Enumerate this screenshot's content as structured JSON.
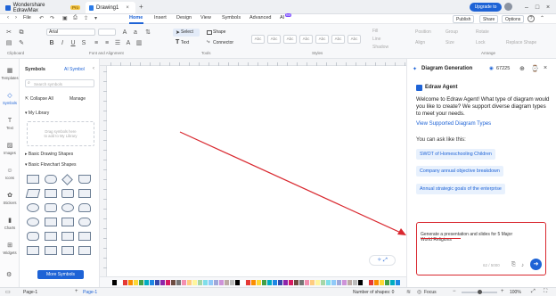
{
  "titlebar": {
    "app_tab": "Wondershare EdrawMax",
    "pro": "Pro",
    "doc_tab": "Drawing1",
    "upgrade": "Upgrade to"
  },
  "menubar": {
    "file": "File",
    "items": [
      "Home",
      "Insert",
      "Design",
      "View",
      "Symbols",
      "Advanced",
      "AI"
    ],
    "ai_badge": "hot",
    "publish": "Publish",
    "share": "Share",
    "options": "Options"
  },
  "ribbon": {
    "font": "Arial",
    "select": "Select",
    "shape": "Shape",
    "text": "Text",
    "connector": "Connector",
    "style_label": "Abc",
    "fill": "Fill",
    "line": "Line",
    "shadow": "Shadow",
    "position": "Position",
    "align": "Align",
    "size": "Size",
    "group": "Group",
    "rotate": "Rotate",
    "lock": "Lock",
    "replace_shape": "Replace Shape",
    "groups": [
      "Clipboard",
      "Font and Alignment",
      "Tools",
      "Styles",
      "Arrange"
    ]
  },
  "rail": [
    "Templates",
    "Symbols",
    "Text",
    "Images",
    "Icons",
    "Stickers",
    "Charts",
    "Widgets"
  ],
  "symbols": {
    "title": "Symbols",
    "ai_symbol": "AI Symbol",
    "search_placeholder": "Search symbols",
    "collapse": "Collapse All",
    "manage": "Manage",
    "library": "My Library",
    "drag_hint_1": "Drag symbols here",
    "drag_hint_2": "to add to My Library",
    "basic_drawing": "Basic Drawing Shapes",
    "basic_flowchart": "Basic Flowchart Shapes",
    "more": "More Symbols"
  },
  "panel": {
    "title": "Diagram Generation",
    "credits": "67225",
    "agent": "Edraw Agent",
    "intro": "Welcome to Edraw Agent! What type of diagram would you like to create? We support diverse diagram types to meet your needs.",
    "view_link": "View Supported Diagram Types",
    "ask": "You can ask like this:",
    "suggestions": [
      "SWOT of Homeschooling Children",
      "Company annual objective breakdown",
      "Annual strategic goals of the enterprise"
    ],
    "input_value": "Generate a presentation and slides for 5 Major World Religions",
    "counter": "62 / 5000"
  },
  "statusbar": {
    "page_select": "Page-1",
    "page_tab": "Page-1",
    "shapes": "Number of shapes: 0",
    "focus": "Focus",
    "zoom": "100%"
  },
  "colors": {
    "accent": "#1e63d6",
    "highlight": "#d9282f"
  }
}
